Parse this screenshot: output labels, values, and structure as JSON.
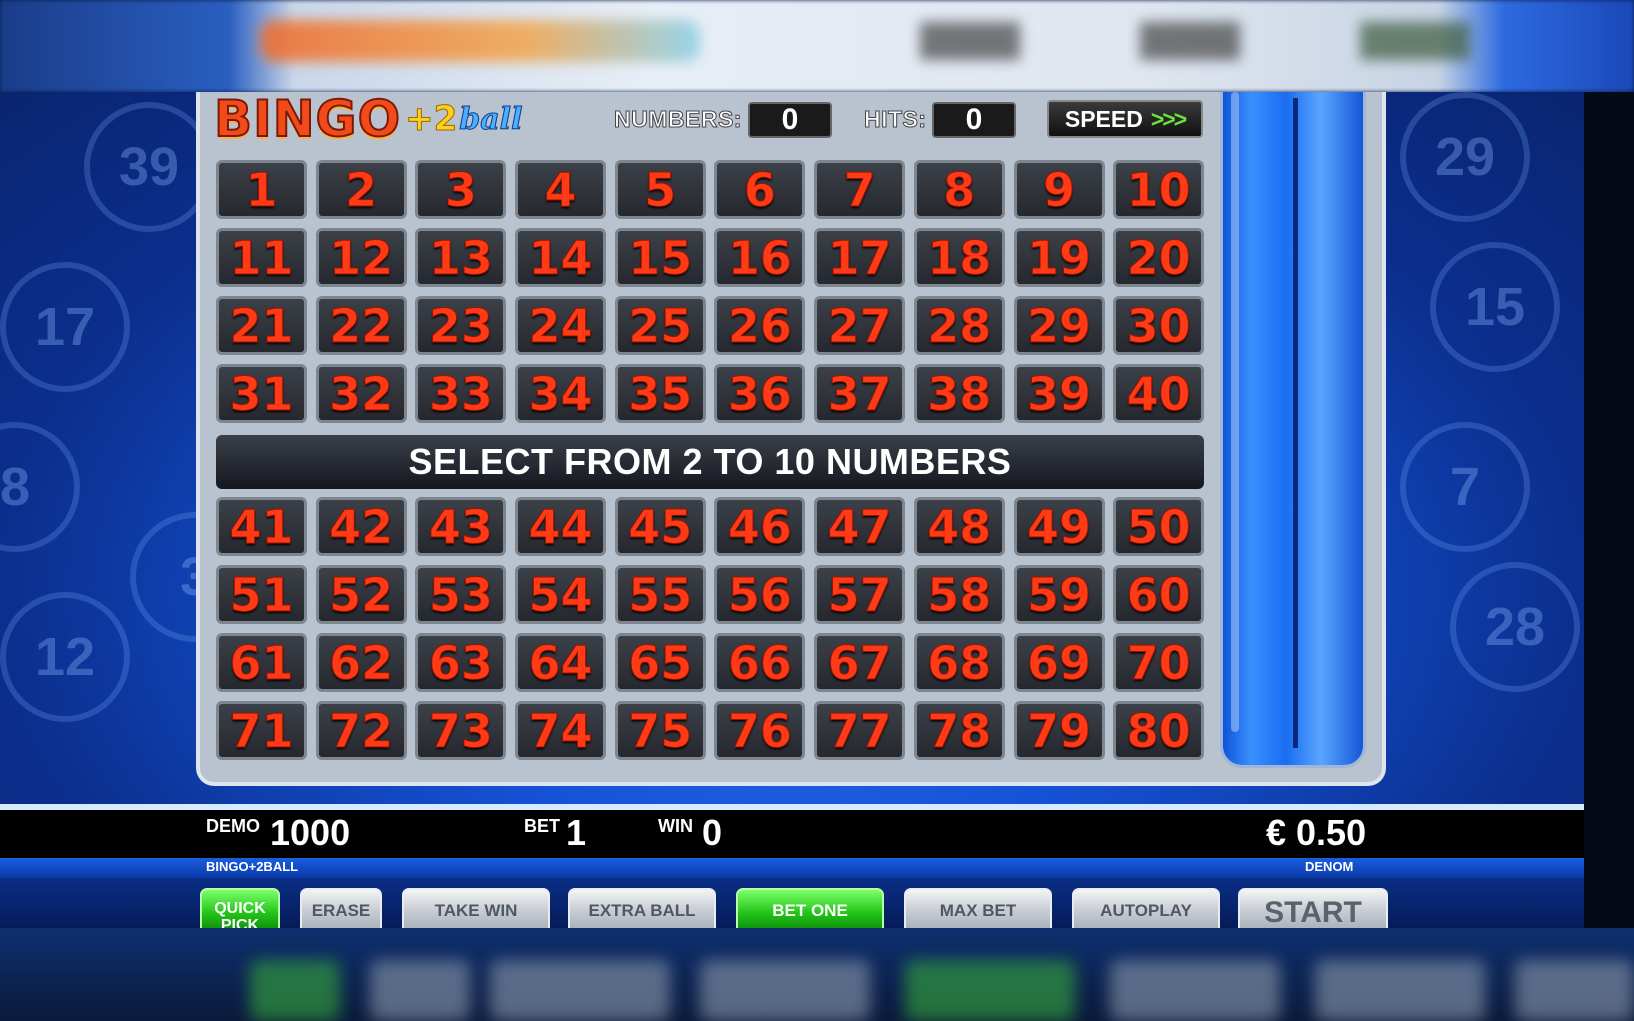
{
  "game": {
    "title_word": "BINGO",
    "title_plus": "+2",
    "title_suffix": "ball"
  },
  "header": {
    "numbers_label": "NUMBERS:",
    "numbers_value": "0",
    "hits_label": "HITS:",
    "hits_value": "0",
    "speed_label": "SPEED",
    "speed_arrows": ">>>"
  },
  "board": {
    "numbers_top": [
      1,
      2,
      3,
      4,
      5,
      6,
      7,
      8,
      9,
      10,
      11,
      12,
      13,
      14,
      15,
      16,
      17,
      18,
      19,
      20,
      21,
      22,
      23,
      24,
      25,
      26,
      27,
      28,
      29,
      30,
      31,
      32,
      33,
      34,
      35,
      36,
      37,
      38,
      39,
      40
    ],
    "numbers_bottom": [
      41,
      42,
      43,
      44,
      45,
      46,
      47,
      48,
      49,
      50,
      51,
      52,
      53,
      54,
      55,
      56,
      57,
      58,
      59,
      60,
      61,
      62,
      63,
      64,
      65,
      66,
      67,
      68,
      69,
      70,
      71,
      72,
      73,
      74,
      75,
      76,
      77,
      78,
      79,
      80
    ],
    "instruction": "SELECT FROM 2 TO 10 NUMBERS"
  },
  "background_balls": [
    "39",
    "17",
    "12",
    "15",
    "7",
    "29",
    "28",
    "8",
    "3"
  ],
  "info": {
    "demo_label": "DEMO",
    "demo_value": "1000",
    "bet_label": "BET",
    "bet_value": "1",
    "win_label": "WIN",
    "win_value": "0",
    "denom_value": "€ 0.50",
    "game_name": "BINGO+2BALL",
    "denom_label": "DENOM"
  },
  "buttons": {
    "quick_pick": "QUICK PICK",
    "erase": "ERASE",
    "take_win": "TAKE WIN",
    "extra_ball": "EXTRA BALL",
    "bet_one": "BET ONE",
    "max_bet": "MAX BET",
    "autoplay": "AUTOPLAY",
    "start": "START"
  },
  "colors": {
    "number_red": "#ff3a16",
    "cell_dark": "#2b2f36",
    "accent_green": "#23c31a",
    "background_blue": "#1553d8"
  }
}
